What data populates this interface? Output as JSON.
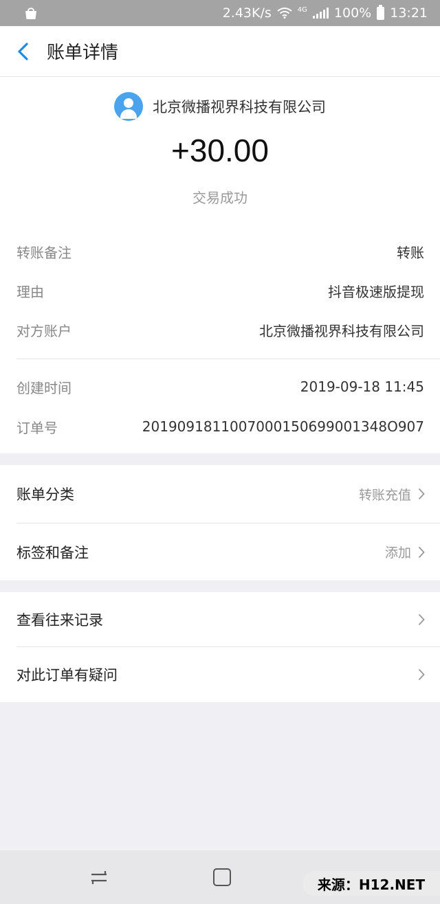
{
  "status_bar": {
    "speed": "2.43K/s",
    "network": "4G",
    "battery": "100%",
    "time": "13:21"
  },
  "header": {
    "title": "账单详情"
  },
  "summary": {
    "merchant": "北京微播视界科技有限公司",
    "amount": "+30.00",
    "status": "交易成功"
  },
  "details": [
    {
      "label": "转账备注",
      "value": "转账"
    },
    {
      "label": "理由",
      "value": "抖音极速版提现"
    },
    {
      "label": "对方账户",
      "value": "北京微播视界科技有限公司"
    },
    {
      "label": "创建时间",
      "value": "2019-09-18 11:45"
    },
    {
      "label": "订单号",
      "value": "2019091811007000150699001348O907"
    }
  ],
  "category_section": [
    {
      "label": "账单分类",
      "value": "转账充值"
    },
    {
      "label": "标签和备注",
      "value": "添加"
    }
  ],
  "links_section": [
    {
      "label": "查看往来记录"
    },
    {
      "label": "对此订单有疑问"
    }
  ],
  "watermark": "来源：H12.NET",
  "colors": {
    "accent": "#1a8ce6",
    "avatar": "#49a3ef",
    "status_bar": "#a4a4a4",
    "background": "#efeff4"
  }
}
